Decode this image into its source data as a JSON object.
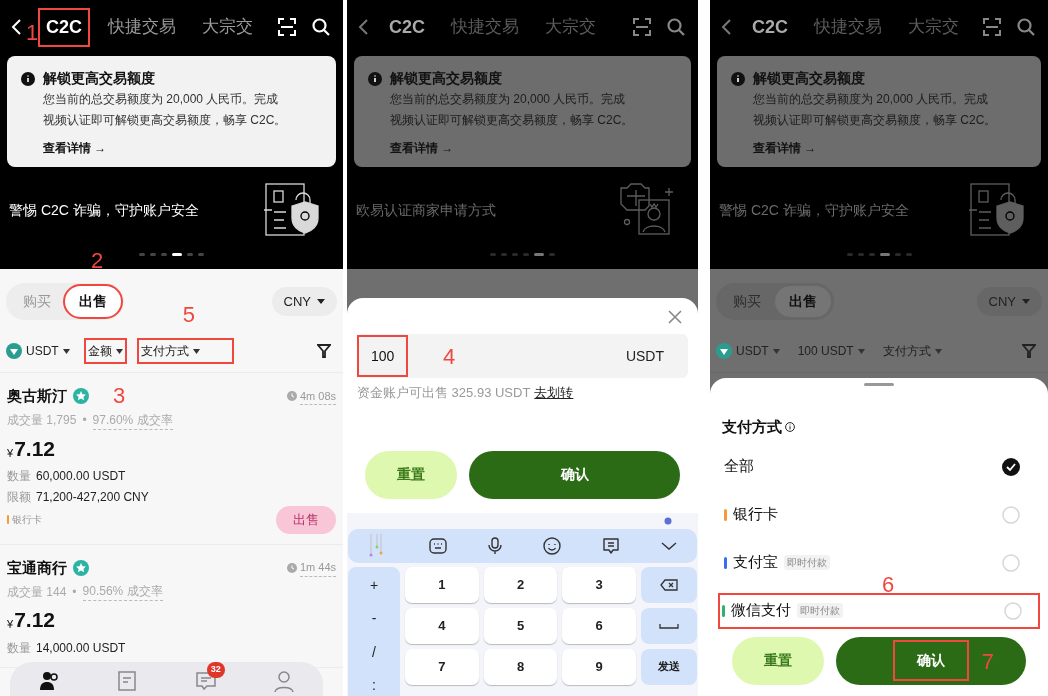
{
  "panels": [
    {
      "kind": "market",
      "dimmed": false,
      "header": {
        "tabs": [
          {
            "label": "C2C",
            "selected": true,
            "highlighted": true,
            "annotation": "1"
          },
          {
            "label": "快捷交易",
            "selected": false,
            "highlighted": false
          },
          {
            "label": "大宗交",
            "selected": false,
            "highlighted": false
          }
        ]
      },
      "notice": {
        "title": "解锁更高交易额度",
        "body_lines": [
          "您当前的总交易额度为 20,000 人民币。完成",
          "视频认证即可解锁更高交易额度，畅享 C2C。"
        ],
        "link": "查看详情 →"
      },
      "banner": {
        "kind": "security",
        "text": "警惕 C2C 诈骗，守护账户安全",
        "dots": [
          {
            "selected": false
          },
          {
            "selected": false
          },
          {
            "selected": false
          },
          {
            "selected": true
          },
          {
            "selected": false
          },
          {
            "selected": false
          }
        ]
      },
      "side_toggle": [
        {
          "label": "购买",
          "selected": false,
          "highlighted": false
        },
        {
          "label": "出售",
          "selected": true,
          "highlighted": true,
          "annotation": "2"
        }
      ],
      "currency": "CNY",
      "filters": [
        {
          "kind": "coin",
          "label": "USDT",
          "highlighted": false
        },
        {
          "kind": "plain",
          "label": "金额",
          "highlighted": true
        },
        {
          "kind": "plain",
          "label": "支付方式",
          "highlighted": true,
          "annotation": "5"
        }
      ],
      "ads": [
        {
          "name": "奥古斯汀",
          "annotation": "3",
          "timer": "4m 08s",
          "volume": "成交量 1,795",
          "separator": "•",
          "rate": "97.60% 成交率",
          "currency_symbol": "¥",
          "price": "7.12",
          "quantity_label": "数量",
          "quantity": "60,000.00 USDT",
          "limit_label": "限额",
          "limit": "71,200-427,200 CNY",
          "payment": "银行卡",
          "color": "#f59a3b",
          "button": "出售"
        },
        {
          "name": "宝通商行",
          "timer": "1m 44s",
          "volume": "成交量 144",
          "separator": "•",
          "rate": "90.56% 成交率",
          "currency_symbol": "¥",
          "price": "7.12",
          "quantity_label": "数量",
          "quantity": "14,000.00 USDT"
        }
      ],
      "bottom_nav": [
        {
          "kind": "p2p",
          "selected": true
        },
        {
          "kind": "orders",
          "selected": false
        },
        {
          "kind": "chat",
          "selected": false,
          "badge": "32"
        },
        {
          "kind": "profile",
          "selected": false
        }
      ]
    },
    {
      "kind": "amount_sheet",
      "dimmed": true,
      "header": {
        "tabs": [
          {
            "label": "C2C",
            "selected": true,
            "highlighted": false
          },
          {
            "label": "快捷交易",
            "selected": false,
            "highlighted": false
          },
          {
            "label": "大宗交",
            "selected": false,
            "highlighted": false
          }
        ]
      },
      "notice": {
        "title": "解锁更高交易额度",
        "body_lines": [
          "您当前的总交易额度为 20,000 人民币。完成",
          "视频认证即可解锁更高交易额度，畅享 C2C。"
        ],
        "link": "查看详情 →"
      },
      "banner": {
        "kind": "merchant",
        "text": "欧易认证商家申请方式",
        "dots": [
          {
            "selected": false
          },
          {
            "selected": false
          },
          {
            "selected": false
          },
          {
            "selected": false
          },
          {
            "selected": true
          },
          {
            "selected": false
          }
        ]
      },
      "sheet": {
        "value": "100",
        "highlighted": true,
        "annotation": "4",
        "unit": "USDT",
        "available": "资金账户可出售 325.93 USDT",
        "transfer_link": "去划转",
        "buttons": [
          {
            "kind": "reset",
            "label": "重置",
            "highlighted": false
          },
          {
            "kind": "confirm",
            "label": "确认",
            "highlighted": false
          }
        ]
      },
      "keyboard": {
        "left_keys": [
          "+",
          "-",
          "/",
          ":"
        ],
        "digits": [
          "1",
          "2",
          "3",
          "4",
          "5",
          "6",
          "7",
          "8",
          "9"
        ],
        "right_keys": [
          {
            "kind": "backspace"
          },
          {
            "kind": "space"
          },
          {
            "kind": "send",
            "label": "发送"
          }
        ]
      }
    },
    {
      "kind": "payment_sheet",
      "dimmed": true,
      "header": {
        "tabs": [
          {
            "label": "C2C",
            "selected": true,
            "highlighted": false
          },
          {
            "label": "快捷交易",
            "selected": false,
            "highlighted": false
          },
          {
            "label": "大宗交",
            "selected": false,
            "highlighted": false
          }
        ]
      },
      "notice": {
        "title": "解锁更高交易额度",
        "body_lines": [
          "您当前的总交易额度为 20,000 人民币。完成",
          "视频认证即可解锁更高交易额度，畅享 C2C。"
        ],
        "link": "查看详情 →"
      },
      "banner": {
        "kind": "security",
        "text": "警惕 C2C 诈骗，守护账户安全",
        "dots": [
          {
            "selected": false
          },
          {
            "selected": false
          },
          {
            "selected": false
          },
          {
            "selected": true
          },
          {
            "selected": false
          },
          {
            "selected": false
          }
        ]
      },
      "side_toggle": [
        {
          "label": "购买",
          "selected": false,
          "highlighted": false
        },
        {
          "label": "出售",
          "selected": true,
          "highlighted": false
        }
      ],
      "currency": "CNY",
      "filters": [
        {
          "kind": "coin",
          "label": "USDT",
          "highlighted": false
        },
        {
          "kind": "plain",
          "label": "100 USDT",
          "highlighted": false
        },
        {
          "kind": "plain",
          "label": "支付方式",
          "highlighted": false
        }
      ],
      "sheet": {
        "title": "支付方式",
        "options": [
          {
            "label": "全部",
            "selected": true,
            "highlighted": false
          },
          {
            "label": "银行卡",
            "color": "#f59a3b",
            "selected": false,
            "highlighted": false
          },
          {
            "label": "支付宝",
            "color": "#3b6cf5",
            "tag": "即时付款",
            "selected": false,
            "highlighted": false
          },
          {
            "label": "微信支付",
            "color": "#2fb36b",
            "tag": "即时付款",
            "selected": false,
            "highlighted": true,
            "annotation": "6"
          }
        ],
        "buttons": [
          {
            "kind": "reset",
            "label": "重置",
            "highlighted": false
          },
          {
            "kind": "confirm",
            "label": "确认",
            "highlighted": true,
            "annotation": "7"
          }
        ]
      }
    }
  ]
}
